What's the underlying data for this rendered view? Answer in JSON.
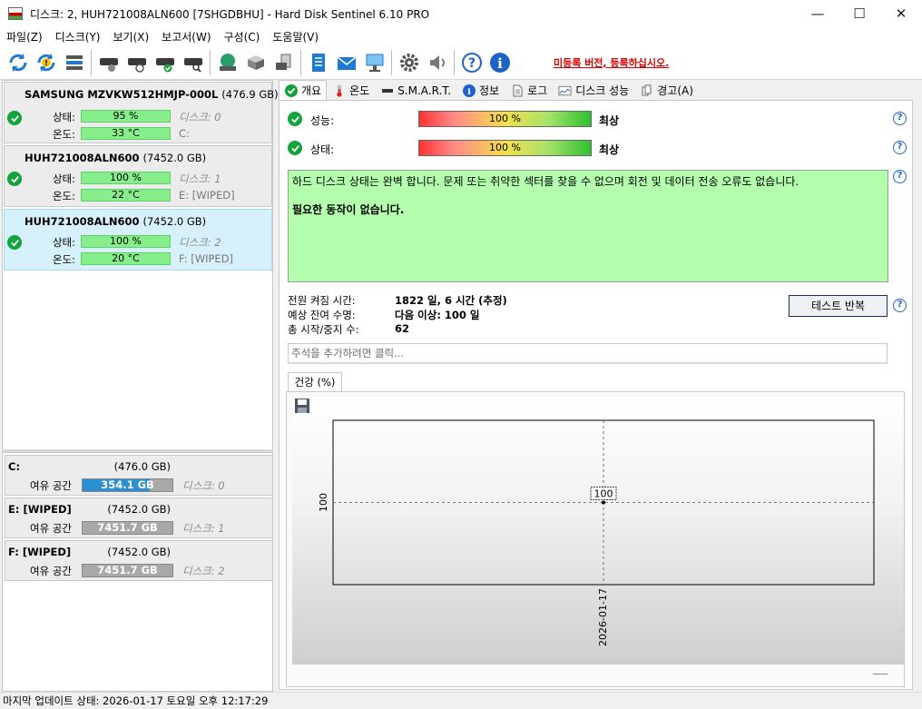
{
  "window": {
    "title": "디스크: 2, HUH721008ALN600 [7SHGDBHU]  -  Hard Disk Sentinel 6.10 PRO",
    "minimize": "—",
    "maximize": "☐",
    "close": "✕"
  },
  "menu": [
    "파일(Z)",
    "디스크(Y)",
    "보기(X)",
    "보고서(W)",
    "구성(C)",
    "도움말(V)"
  ],
  "toolbar": {
    "icons": [
      "refresh-icon",
      "refresh-all-icon",
      "disk-list-icon",
      "disk-test-icon",
      "disk-schedule-icon",
      "disk-ok-icon",
      "disk-search-icon",
      "network-icon",
      "server-icon",
      "remote-icon",
      "report-icon",
      "email-icon",
      "network-report-icon",
      "settings-icon",
      "sound-icon",
      "help-icon",
      "info-icon"
    ],
    "register_link": "미등록 버전, 등록하십시오."
  },
  "disks": [
    {
      "name": "SAMSUNG MZVKW512HMJP-000L",
      "size": "(476.9 GB)",
      "status_label": "상태:",
      "status_value": "95 %",
      "status_pct": 95,
      "temp_label": "온도:",
      "temp_value": "33 °C",
      "disk_ref": "디스크: 0",
      "volume": "C:"
    },
    {
      "name": "HUH721008ALN600",
      "size": "(7452.0 GB)",
      "status_label": "상태:",
      "status_value": "100 %",
      "status_pct": 100,
      "temp_label": "온도:",
      "temp_value": "22 °C",
      "disk_ref": "디스크: 1",
      "volume": "E: [WIPED]"
    },
    {
      "name": "HUH721008ALN600",
      "size": "(7452.0 GB)",
      "status_label": "상태:",
      "status_value": "100 %",
      "status_pct": 100,
      "temp_label": "온도:",
      "temp_value": "20 °C",
      "disk_ref": "디스크: 2",
      "volume": "F: [WIPED]"
    }
  ],
  "volumes": [
    {
      "name": "C:",
      "size": "(476.0 GB)",
      "free_label": "여유 공간",
      "free_value": "354.1 GB",
      "free_fraction": 0.744,
      "disk_ref": "디스크: 0"
    },
    {
      "name": "E: [WIPED]",
      "size": "(7452.0 GB)",
      "free_label": "여유 공간",
      "free_value": "7451.7 GB",
      "free_fraction": 0.0,
      "disk_ref": "디스크: 1"
    },
    {
      "name": "F: [WIPED]",
      "size": "(7452.0 GB)",
      "free_label": "여유 공간",
      "free_value": "7451.7 GB",
      "free_fraction": 0.0,
      "disk_ref": "디스크: 2"
    }
  ],
  "tabs": [
    "개요",
    "온도",
    "S.M.A.R.T.",
    "정보",
    "로그",
    "디스크 성능",
    "경고(A)"
  ],
  "overview": {
    "performance_label": "성능:",
    "performance_value": "100 %",
    "performance_rating": "최상",
    "health_label": "상태:",
    "health_value": "100 %",
    "health_rating": "최상",
    "description": "하드 디스크 상태는 완벽 합니다. 문제 또는 취약한 섹터를 찾을 수 없으며 회전 및 데이터 전송 오류도 없습니다.",
    "action": "필요한 동작이 없습니다.",
    "power_on_label": "전원 켜짐 시간:",
    "power_on_value": "1822 일, 6 시간 (추정)",
    "lifetime_label": "예상 잔여 수명:",
    "lifetime_value": "다음 이상: 100 일",
    "start_stop_label": "총 시작/중지 수:",
    "start_stop_value": "62",
    "test_button": "테스트 반복",
    "note_placeholder": "주석을 추가하려면 클릭...",
    "health_tab": "건강 (%)"
  },
  "chart_data": {
    "type": "line",
    "x": [
      "2026-01-17"
    ],
    "series": [
      {
        "values": [
          100
        ]
      }
    ],
    "data_labels": [
      "100"
    ],
    "y_tick_labels": [
      "100"
    ],
    "x_tick_labels": [
      "2026-01-17"
    ],
    "grid": false
  },
  "statusbar": {
    "text": "마지막 업데이트 상태: 2026-01-17 토요일 오후 12:17:29"
  }
}
